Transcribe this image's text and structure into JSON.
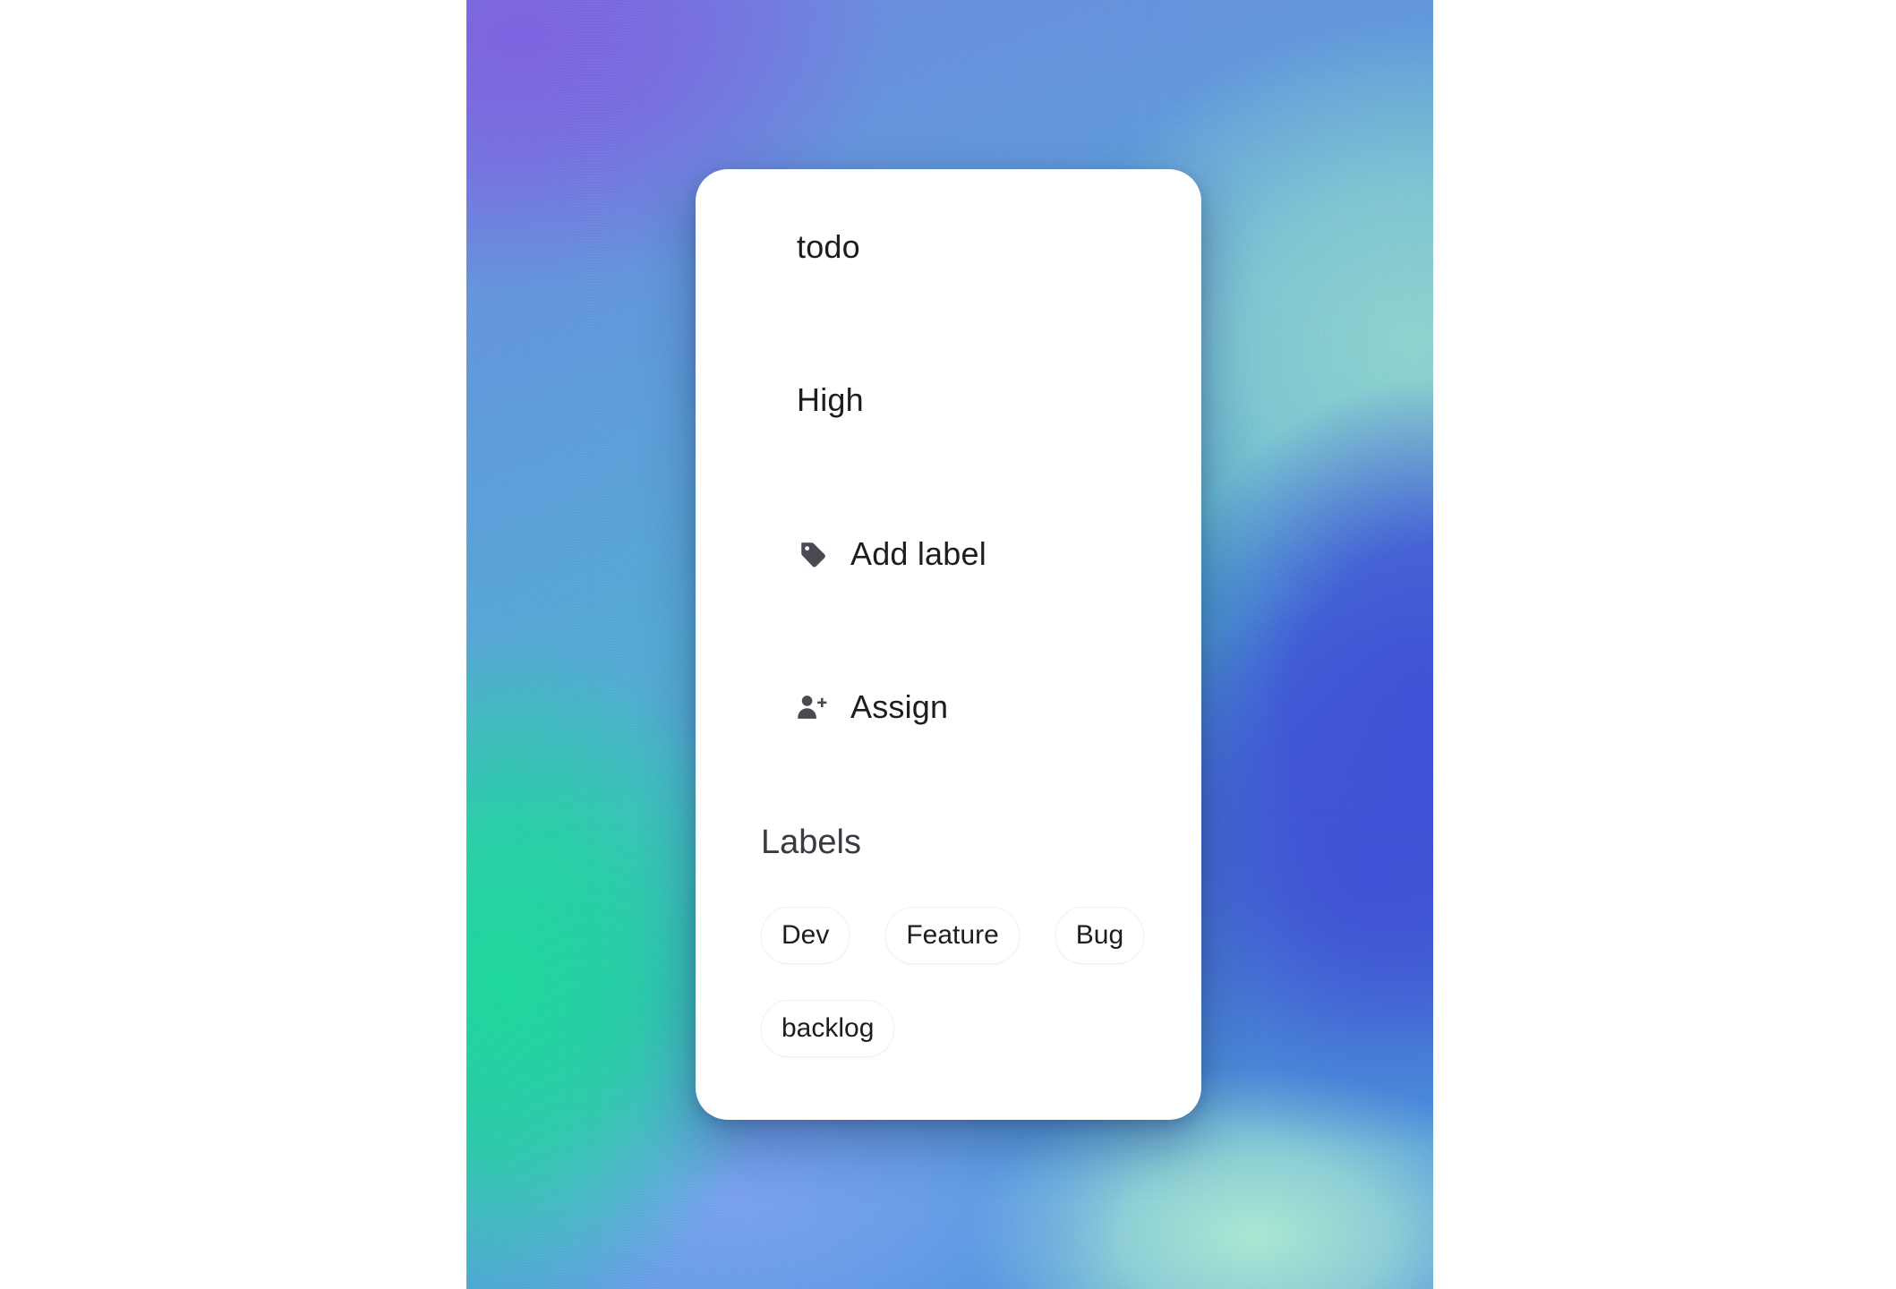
{
  "card": {
    "status": "todo",
    "priority": "High",
    "add_label": {
      "label": "Add label",
      "icon": "tag-icon"
    },
    "assign": {
      "label": "Assign",
      "icon": "user-plus-icon"
    },
    "labels_section": {
      "title": "Labels",
      "chips": [
        "Dev",
        "Feature",
        "Bug",
        "backlog"
      ]
    }
  },
  "colors": {
    "card_background": "#ffffff",
    "text": "#1c1d21",
    "icon": "#4a4b52"
  }
}
